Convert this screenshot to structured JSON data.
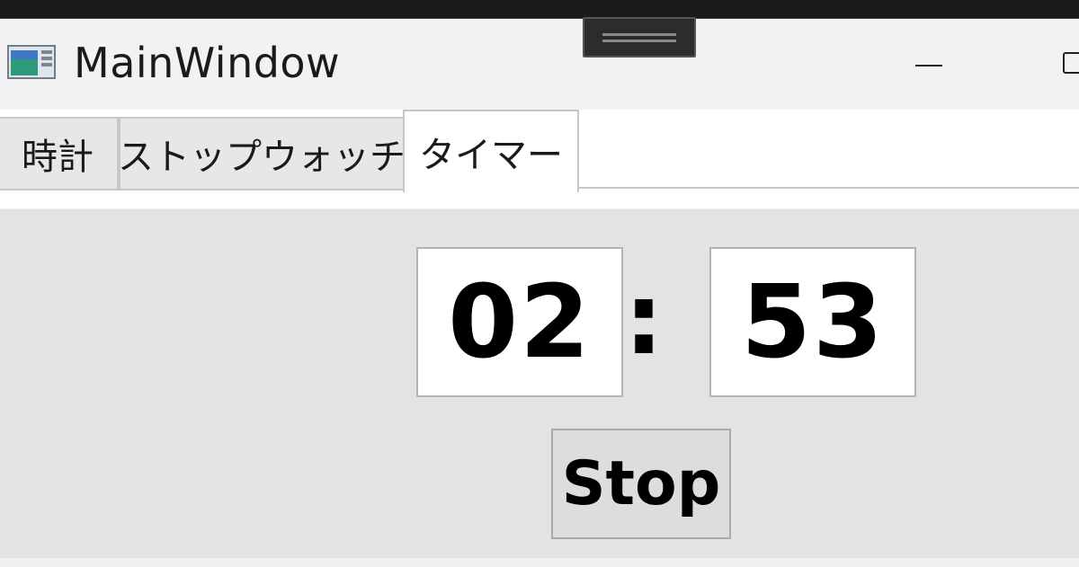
{
  "window": {
    "title": "MainWindow"
  },
  "tabs": [
    {
      "label": "時計",
      "selected": false
    },
    {
      "label": "ストップウォッチ",
      "selected": false
    },
    {
      "label": "タイマー",
      "selected": true
    }
  ],
  "timer": {
    "minutes": "02",
    "separator": ":",
    "seconds": "53",
    "stop_label": "Stop"
  },
  "icons": {
    "app": "app-window-icon",
    "minimize": "minimize-icon",
    "maximize": "maximize-icon",
    "snap": "snap-layout-handle-icon"
  },
  "colors": {
    "content_bg": "#e3e3e3",
    "titlebar_bg": "#f2f2f2",
    "selected_tab_bg": "#ffffff",
    "tab_bg": "#e7e7e7"
  }
}
